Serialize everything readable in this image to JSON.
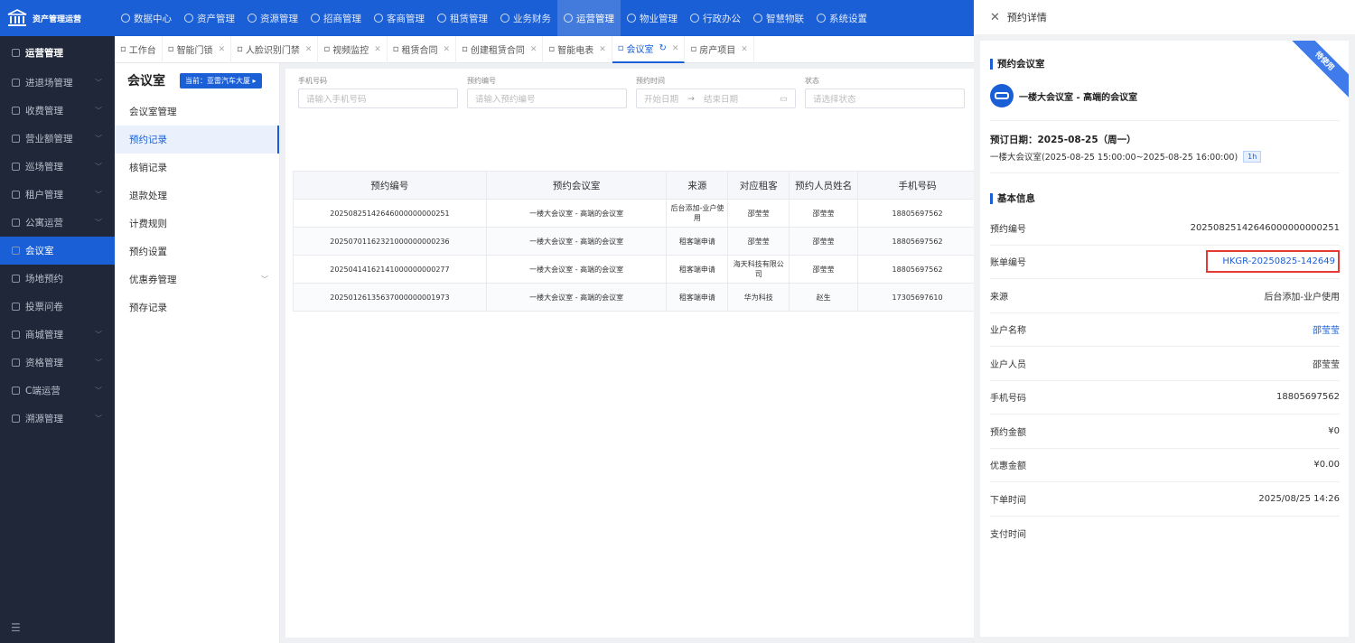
{
  "brand": {
    "name": "资产管理运营"
  },
  "topnav": [
    {
      "label": "数据中心",
      "active": false
    },
    {
      "label": "资产管理",
      "active": false
    },
    {
      "label": "资源管理",
      "active": false
    },
    {
      "label": "招商管理",
      "active": false
    },
    {
      "label": "客商管理",
      "active": false
    },
    {
      "label": "租赁管理",
      "active": false
    },
    {
      "label": "业务财务",
      "active": false
    },
    {
      "label": "运营管理",
      "active": true
    },
    {
      "label": "物业管理",
      "active": false
    },
    {
      "label": "行政办公",
      "active": false
    },
    {
      "label": "智慧物联",
      "active": false
    },
    {
      "label": "系统设置",
      "active": false
    }
  ],
  "sidebar": {
    "header": "运营管理",
    "items": [
      {
        "label": "进退场管理",
        "has_children": true,
        "active": false
      },
      {
        "label": "收费管理",
        "has_children": true,
        "active": false
      },
      {
        "label": "营业额管理",
        "has_children": true,
        "active": false
      },
      {
        "label": "巡场管理",
        "has_children": true,
        "active": false
      },
      {
        "label": "租户管理",
        "has_children": true,
        "active": false
      },
      {
        "label": "公寓运营",
        "has_children": true,
        "active": false
      },
      {
        "label": "会议室",
        "has_children": false,
        "active": true
      },
      {
        "label": "场地预约",
        "has_children": false,
        "active": false
      },
      {
        "label": "投票问卷",
        "has_children": false,
        "active": false
      },
      {
        "label": "商城管理",
        "has_children": true,
        "active": false
      },
      {
        "label": "资格管理",
        "has_children": true,
        "active": false
      },
      {
        "label": "C端运营",
        "has_children": true,
        "active": false
      },
      {
        "label": "溯源管理",
        "has_children": true,
        "active": false
      }
    ],
    "footer_icon": "menu-collapse-icon"
  },
  "tabs": [
    {
      "label": "工作台",
      "closable": false,
      "active": false
    },
    {
      "label": "智能门锁",
      "closable": true,
      "active": false
    },
    {
      "label": "人脸识别门禁",
      "closable": true,
      "active": false
    },
    {
      "label": "视频监控",
      "closable": true,
      "active": false
    },
    {
      "label": "租赁合同",
      "closable": true,
      "active": false
    },
    {
      "label": "创建租赁合同",
      "closable": true,
      "active": false
    },
    {
      "label": "智能电表",
      "closable": true,
      "active": false
    },
    {
      "label": "会议室",
      "closable": true,
      "active": true
    },
    {
      "label": "房产项目",
      "closable": true,
      "active": false
    }
  ],
  "submenu": {
    "title": "会议室",
    "current_badge": "当前：亚雷汽车大厦 ▸",
    "items": [
      {
        "label": "会议室管理",
        "active": false,
        "has_children": false
      },
      {
        "label": "预约记录",
        "active": true,
        "has_children": false
      },
      {
        "label": "核销记录",
        "active": false,
        "has_children": false
      },
      {
        "label": "退款处理",
        "active": false,
        "has_children": false
      },
      {
        "label": "计费规则",
        "active": false,
        "has_children": false
      },
      {
        "label": "预约设置",
        "active": false,
        "has_children": false
      },
      {
        "label": "优惠券管理",
        "active": false,
        "has_children": true
      },
      {
        "label": "预存记录",
        "active": false,
        "has_children": false
      }
    ]
  },
  "filters": {
    "phone": {
      "label": "手机号码",
      "placeholder": "请输入手机号码"
    },
    "booking_no": {
      "label": "预约编号",
      "placeholder": "请输入预约编号"
    },
    "time": {
      "label": "预约时间",
      "start": "开始日期",
      "arrow": "→",
      "end": "结束日期"
    },
    "status": {
      "label": "状态",
      "placeholder": "请选择状态"
    }
  },
  "table": {
    "columns": [
      "预约编号",
      "预约会议室",
      "来源",
      "对应租客",
      "预约人员姓名",
      "手机号码"
    ],
    "rows": [
      [
        "20250825142646000000000251",
        "一楼大会议室 - 高端的会议室",
        "后台添加-业户使用",
        "邵莹莹",
        "邵莹莹",
        "18805697562"
      ],
      [
        "20250701162321000000000236",
        "一楼大会议室 - 高端的会议室",
        "租客端申请",
        "邵莹莹",
        "邵莹莹",
        "18805697562"
      ],
      [
        "20250414162141000000000277",
        "一楼大会议室 - 高端的会议室",
        "租客端申请",
        "海天科技有限公司",
        "邵莹莹",
        "18805697562"
      ],
      [
        "20250126135637000000001973",
        "一楼大会议室 - 高端的会议室",
        "租客端申请",
        "华为科技",
        "赵生",
        "17305697610"
      ]
    ]
  },
  "drawer": {
    "title": "预约详情",
    "ribbon": "待使用",
    "room_section": "预约会议室",
    "room_name": "一楼大会议室 - 高端的会议室",
    "booking_date": "预订日期：2025-08-25（周一）",
    "booking_detail": "一楼大会议室(2025-08-25 15:00:00~2025-08-25 16:00:00)",
    "duration": "1h",
    "basic_section": "基本信息",
    "fields": [
      {
        "key": "预约编号",
        "value": "20250825142646000000000251",
        "style": "plain"
      },
      {
        "key": "账单编号",
        "value": "HKGR-20250825-142649",
        "style": "boxed"
      },
      {
        "key": "来源",
        "value": "后台添加-业户使用",
        "style": "plain"
      },
      {
        "key": "业户名称",
        "value": "邵莹莹",
        "style": "link"
      },
      {
        "key": "业户人员",
        "value": "邵莹莹",
        "style": "plain"
      },
      {
        "key": "手机号码",
        "value": "18805697562",
        "style": "plain"
      },
      {
        "key": "预约金额",
        "value": "¥0",
        "style": "plain"
      },
      {
        "key": "优惠金额",
        "value": "¥0.00",
        "style": "plain"
      },
      {
        "key": "下单时间",
        "value": "2025/08/25 14:26",
        "style": "plain"
      },
      {
        "key": "支付时间",
        "value": "",
        "style": "plain"
      }
    ]
  },
  "colors": {
    "primary": "#1a5fd6",
    "sidebar_bg": "#1f2738",
    "highlight_border": "#e53935"
  }
}
